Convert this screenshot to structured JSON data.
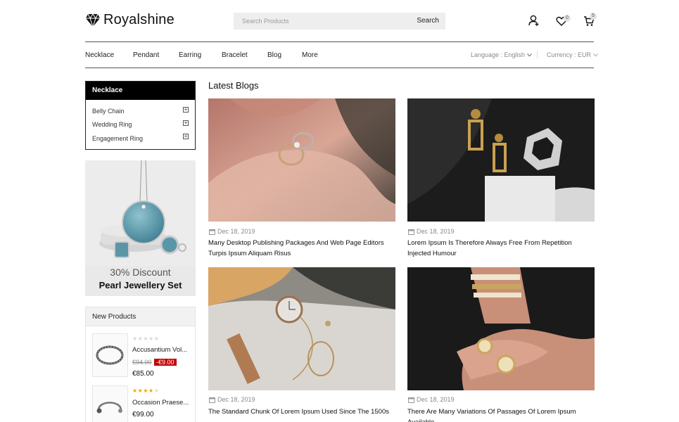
{
  "header": {
    "logo_text": "Royalshine",
    "search_placeholder": "Search Products",
    "search_button": "Search",
    "wishlist_count": "0",
    "cart_count": "5"
  },
  "nav": {
    "items": [
      "Necklace",
      "Pendant",
      "Earring",
      "Bracelet",
      "Blog",
      "More"
    ],
    "language": "Language : English",
    "currency": "Currency : EUR"
  },
  "sidebar": {
    "category_heading": "Necklace",
    "categories": [
      "Belly Chain",
      "Wedding Ring",
      "Engagement Ring"
    ],
    "promo": {
      "discount": "30% Discount",
      "title": "Pearl Jewellery Set"
    },
    "new_products": {
      "heading": "New Products",
      "items": [
        {
          "name": "Accusantium Vol...",
          "old_price": "€94.00",
          "discount": "-€9.00",
          "price": "€85.00",
          "rating": 0
        },
        {
          "name": "Occasion Praese...",
          "old_price": "",
          "discount": "",
          "price": "€99.00",
          "rating": 4
        }
      ]
    }
  },
  "blogs": {
    "heading": "Latest Blogs",
    "posts": [
      {
        "date": "Dec 18, 2019",
        "title": "Many Desktop Publishing Packages And Web Page Editors Turpis Ipsum Aliquam Risus"
      },
      {
        "date": "Dec 18, 2019",
        "title": "Lorem Ipsum Is Therefore Always Free From Repetition Injected Humour"
      },
      {
        "date": "Dec 18, 2019",
        "title": "The Standard Chunk Of Lorem Ipsum Used Since The 1500s"
      },
      {
        "date": "Dec 18, 2019",
        "title": "There Are Many Variations Of Passages Of Lorem Ipsum Available"
      }
    ]
  },
  "colors": {
    "accent_red": "#c40000",
    "star_gold": "#f0a500",
    "nav_text": "#222222"
  },
  "icons": [
    "diamond-icon",
    "user-icon",
    "heart-icon",
    "cart-icon",
    "calendar-icon",
    "plus-icon",
    "chevron-down-icon"
  ]
}
